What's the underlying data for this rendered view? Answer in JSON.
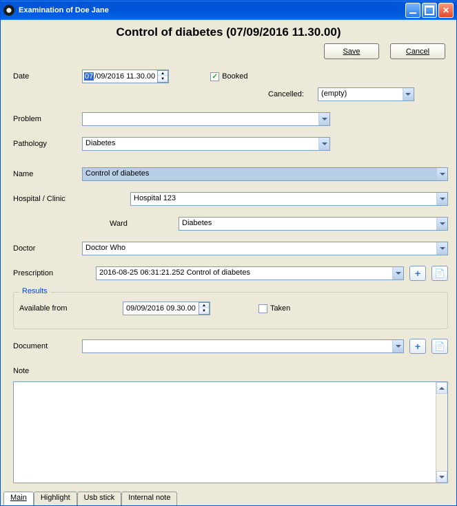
{
  "window": {
    "title": "Examination of Doe Jane"
  },
  "header": {
    "title": "Control of diabetes (07/09/2016 11.30.00)"
  },
  "toolbar": {
    "save": "Save",
    "cancel": "Cancel"
  },
  "labels": {
    "date": "Date",
    "booked": "Booked",
    "cancelled": "Cancelled:",
    "problem": "Problem",
    "pathology": "Pathology",
    "name": "Name",
    "hospital": "Hospital / Clinic",
    "ward": "Ward",
    "doctor": "Doctor",
    "prescription": "Prescription",
    "results": "Results",
    "availablefrom": "Available from",
    "taken": "Taken",
    "document": "Document",
    "note": "Note"
  },
  "fields": {
    "date_day": "07",
    "date_rest": "/09/2016   11.30.00",
    "booked": true,
    "cancelled": "(empty)",
    "problem": "",
    "pathology": "Diabetes",
    "name": "Control of diabetes",
    "hospital": "Hospital 123",
    "ward": "Diabetes",
    "doctor": "Doctor Who",
    "prescription": "2016-08-25 06:31:21.252  Control of diabetes",
    "available_date": "09/09/2016   09.30.00",
    "taken": false,
    "document": "",
    "note": ""
  },
  "tabs": {
    "main": "Main",
    "highlight": "Highlight",
    "usb": "Usb stick",
    "internal": "Internal note"
  }
}
